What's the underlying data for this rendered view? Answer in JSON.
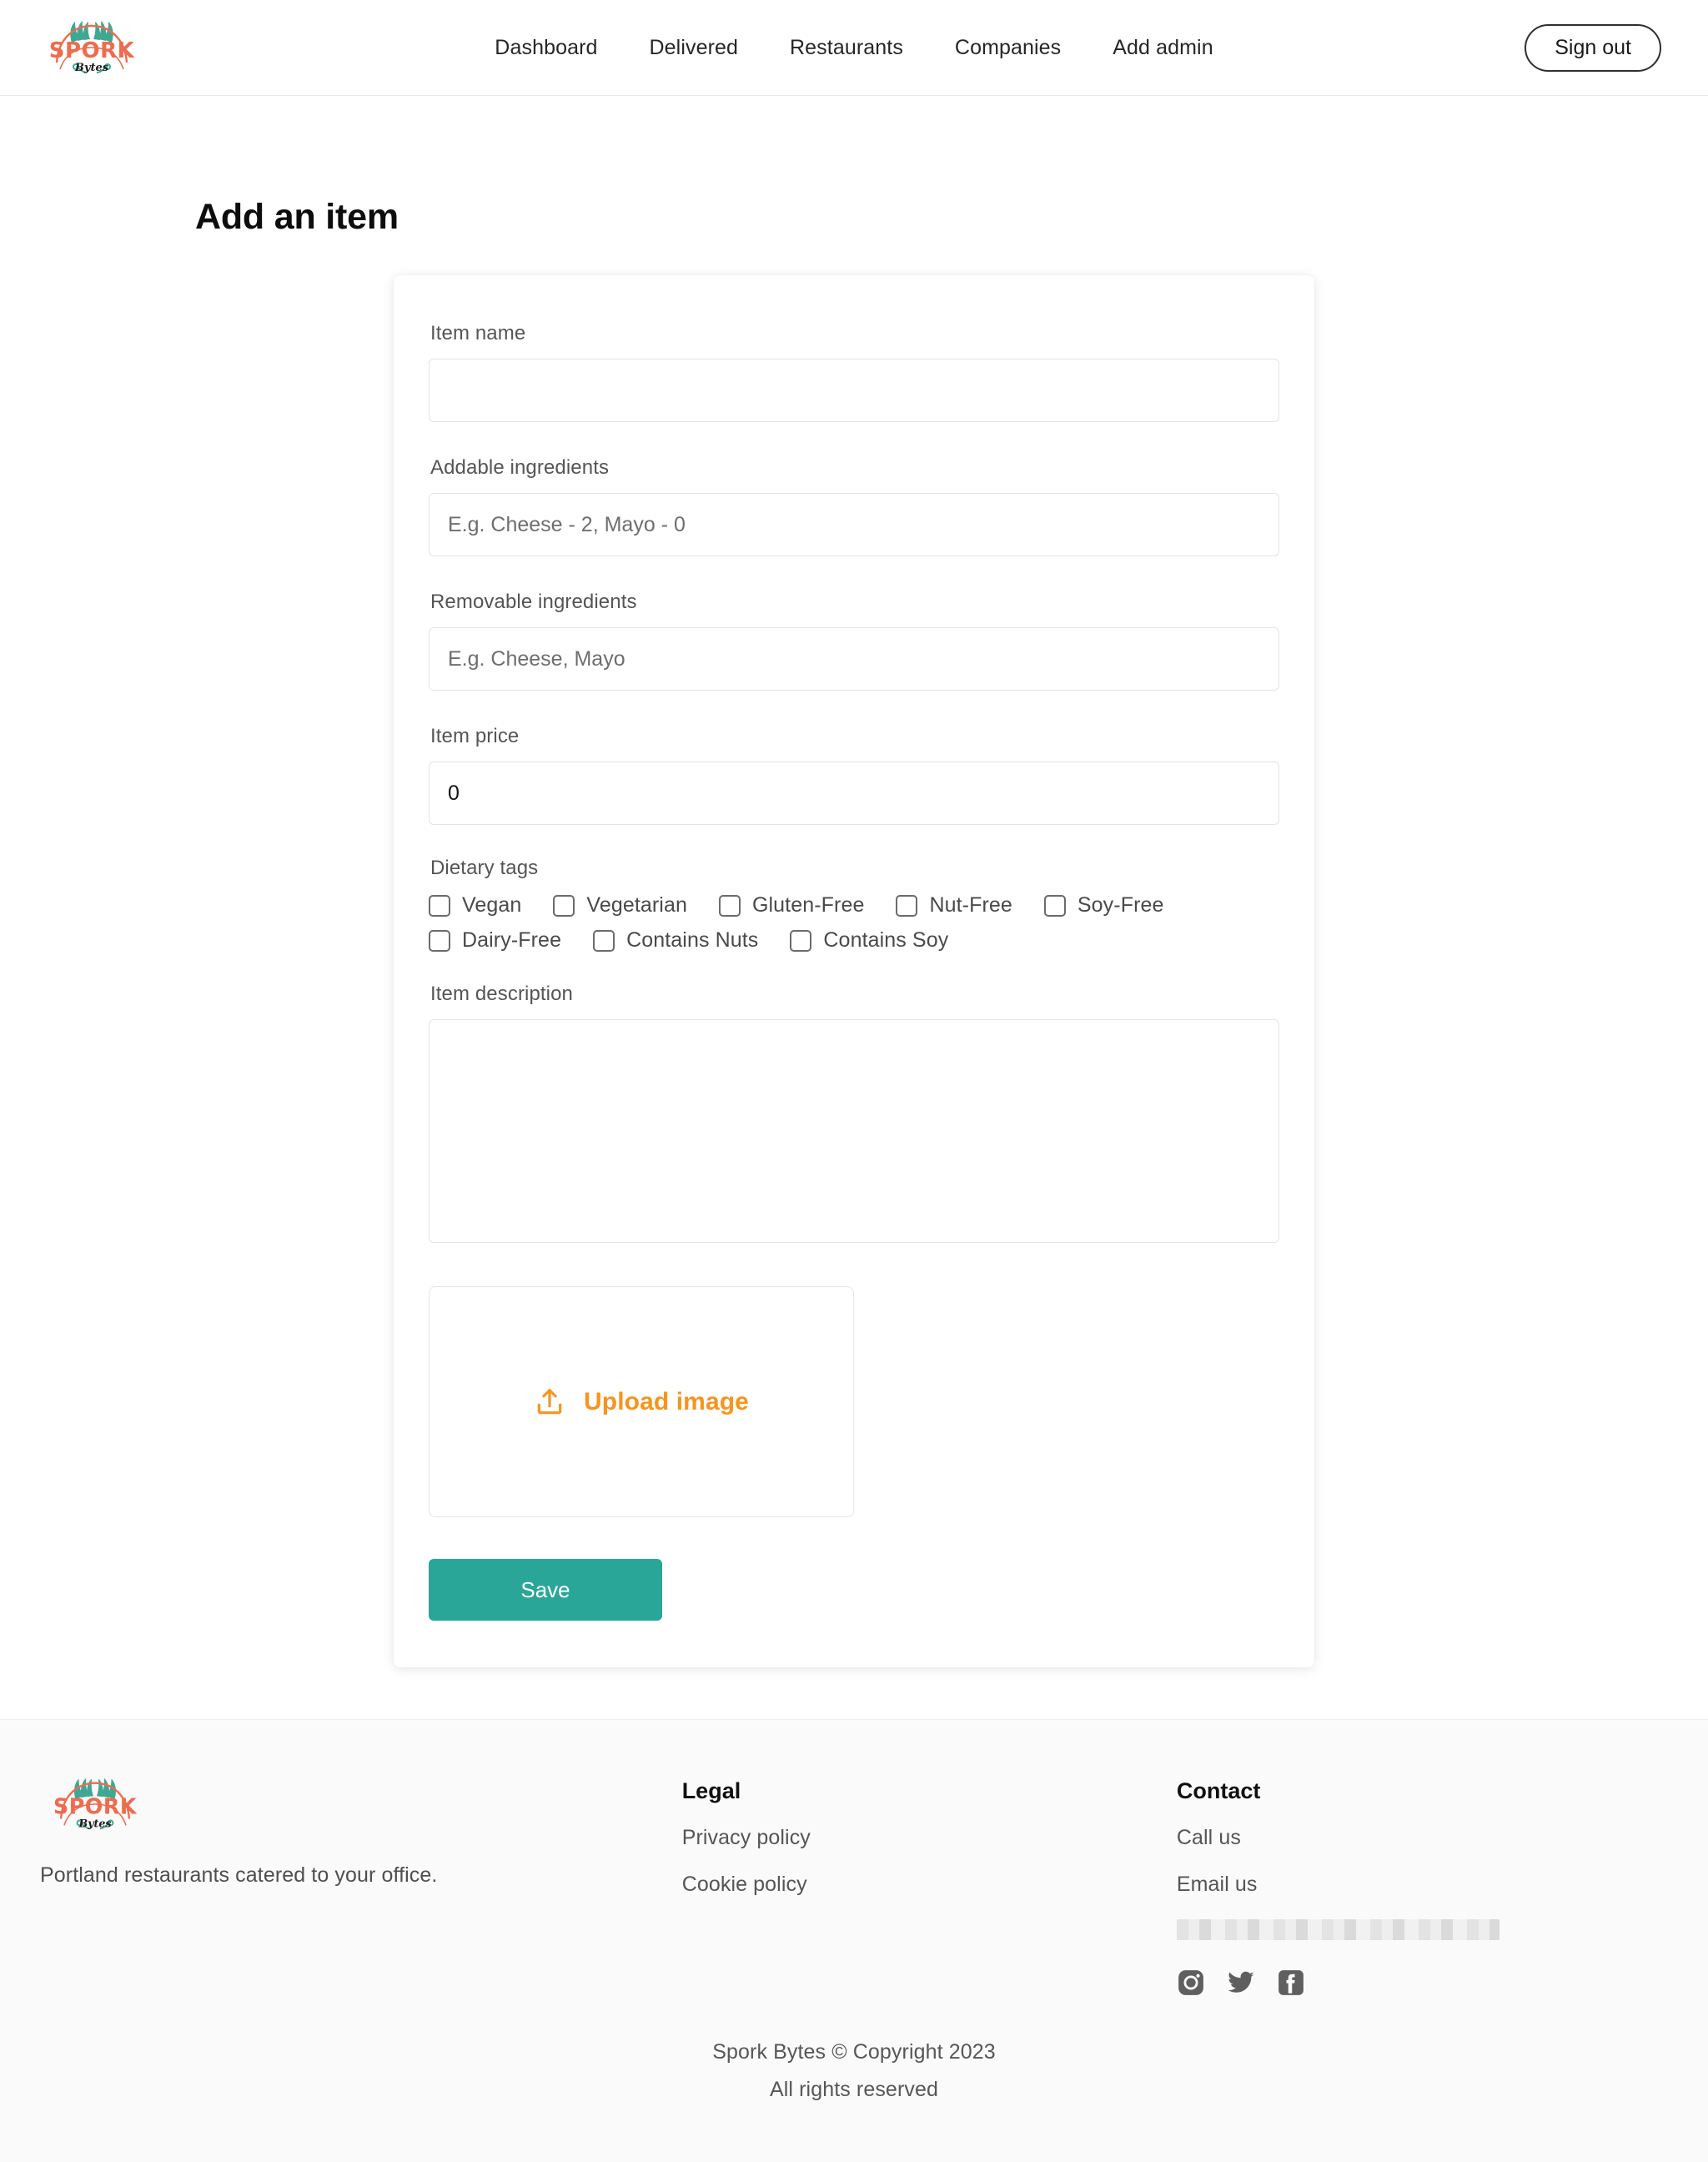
{
  "brand": {
    "logo_wordmark": "SPORK",
    "logo_sub": "Bytes",
    "logo_icon": "spork-bytes-logo"
  },
  "navbar": {
    "links": [
      {
        "label": "Dashboard",
        "name": "nav-link-dashboard"
      },
      {
        "label": "Delivered",
        "name": "nav-link-delivered"
      },
      {
        "label": "Restaurants",
        "name": "nav-link-restaurants"
      },
      {
        "label": "Companies",
        "name": "nav-link-companies"
      },
      {
        "label": "Add admin",
        "name": "nav-link-add-admin"
      }
    ],
    "sign_out_label": "Sign out"
  },
  "page": {
    "title": "Add an item"
  },
  "form": {
    "item_name": {
      "label": "Item name",
      "value": "",
      "placeholder": ""
    },
    "addable_ingredients": {
      "label": "Addable ingredients",
      "value": "",
      "placeholder": "E.g. Cheese - 2, Mayo - 0"
    },
    "removable_ingredients": {
      "label": "Removable ingredients",
      "value": "",
      "placeholder": "E.g. Cheese, Mayo"
    },
    "item_price": {
      "label": "Item price",
      "value": "0",
      "placeholder": ""
    },
    "dietary_tags": {
      "label": "Dietary tags",
      "rows": [
        [
          {
            "label": "Vegan",
            "checked": false
          },
          {
            "label": "Vegetarian",
            "checked": false
          },
          {
            "label": "Gluten-Free",
            "checked": false
          },
          {
            "label": "Nut-Free",
            "checked": false
          },
          {
            "label": "Soy-Free",
            "checked": false
          }
        ],
        [
          {
            "label": "Dairy-Free",
            "checked": false
          },
          {
            "label": "Contains Nuts",
            "checked": false
          },
          {
            "label": "Contains Soy",
            "checked": false
          }
        ]
      ]
    },
    "item_description": {
      "label": "Item description",
      "value": "",
      "placeholder": ""
    },
    "upload": {
      "label": "Upload image",
      "icon": "upload-icon"
    },
    "save_label": "Save"
  },
  "footer": {
    "tagline": "Portland restaurants catered to your office.",
    "legal": {
      "heading": "Legal",
      "links": [
        {
          "label": "Privacy policy"
        },
        {
          "label": "Cookie policy"
        }
      ]
    },
    "contact": {
      "heading": "Contact",
      "links": [
        {
          "label": "Call us"
        },
        {
          "label": "Email us"
        }
      ],
      "redacted_text": ""
    },
    "socials": [
      {
        "name": "instagram-icon"
      },
      {
        "name": "twitter-icon"
      },
      {
        "name": "facebook-icon"
      }
    ],
    "copyright_line1": "Spork Bytes © Copyright 2023",
    "copyright_line2": "All rights reserved"
  },
  "colors": {
    "accent_orange": "#f7941e",
    "accent_teal": "#2aa699",
    "logo_orange": "#ef6b4e",
    "logo_teal": "#3fa893"
  }
}
